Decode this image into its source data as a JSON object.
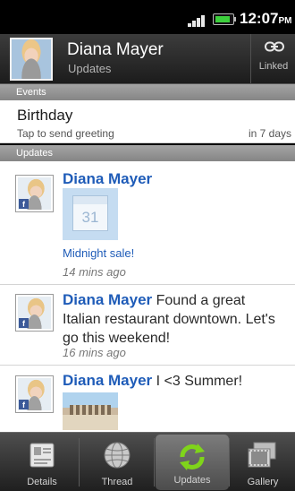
{
  "status_bar": {
    "time": "12:07",
    "ampm": "PM"
  },
  "header": {
    "name": "Diana Mayer",
    "subtitle": "Updates",
    "linked_label": "Linked"
  },
  "sections": {
    "events": "Events",
    "updates": "Updates"
  },
  "event": {
    "title": "Birthday",
    "subtitle": "Tap to send greeting",
    "when": "in 7 days"
  },
  "updates": [
    {
      "name": "Diana Mayer",
      "text": "",
      "thumb_label": "31",
      "link": "Midnight sale!",
      "time": "14 mins ago"
    },
    {
      "name": "Diana Mayer",
      "text_line1": " Found a great",
      "text_line2": "Italian restaurant downtown. Let's",
      "text_line3": "go this weekend!",
      "time": "16 mins ago"
    },
    {
      "name": "Diana Mayer",
      "text": " I <3 Summer!"
    }
  ],
  "tabs": [
    {
      "label": "Details",
      "icon": "details-icon"
    },
    {
      "label": "Thread",
      "icon": "thread-icon"
    },
    {
      "label": "Updates",
      "icon": "updates-icon",
      "active": true
    },
    {
      "label": "Gallery",
      "icon": "gallery-icon"
    }
  ],
  "colors": {
    "link_blue": "#1f5cb8",
    "section_gray": "#9a9a9a",
    "active_green": "#7fd41a"
  }
}
